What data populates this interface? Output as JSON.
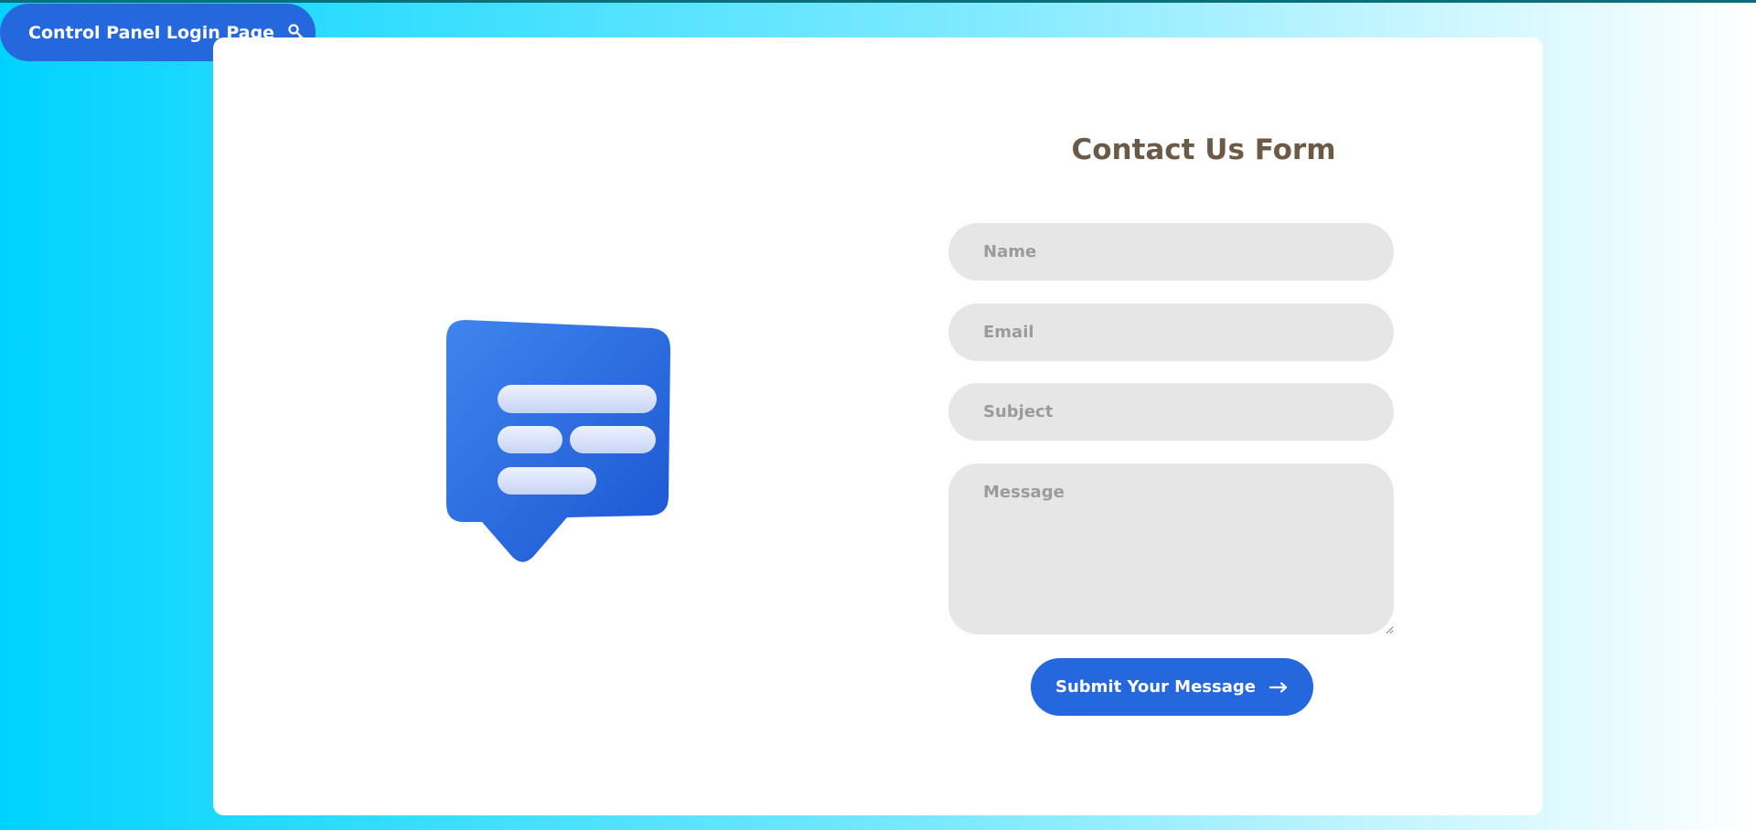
{
  "login_link": {
    "label": "Control Panel Login Page",
    "icon": "key-icon"
  },
  "illustration": {
    "icon": "chat-bubble-icon"
  },
  "contact_form": {
    "title": "Contact Us Form",
    "name_placeholder": "Name",
    "email_placeholder": "Email",
    "subject_placeholder": "Subject",
    "message_placeholder": "Message",
    "submit_label": "Submit Your Message",
    "submit_icon": "arrow-right-icon"
  },
  "colors": {
    "accent": "#2567dc",
    "title": "#6b5a45",
    "field_bg": "#e6e6e6",
    "gradient_start": "#00d2ff"
  }
}
